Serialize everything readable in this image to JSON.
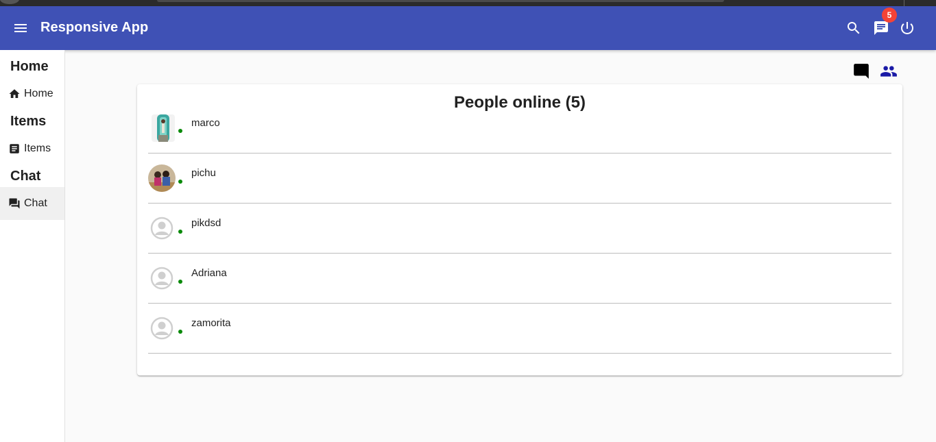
{
  "app": {
    "title": "Responsive App",
    "notification_count": "5"
  },
  "sidebar": {
    "sections": [
      {
        "heading": "Home",
        "item": "Home"
      },
      {
        "heading": "Items",
        "item": "Items"
      },
      {
        "heading": "Chat",
        "item": "Chat"
      }
    ],
    "active": "Chat"
  },
  "main": {
    "title": "People online (5)",
    "people": [
      {
        "name": "marco",
        "avatar": "photo-1",
        "online": true
      },
      {
        "name": "pichu",
        "avatar": "photo-2",
        "online": true
      },
      {
        "name": "pikdsd",
        "avatar": "default-avatar",
        "online": true
      },
      {
        "name": "Adriana",
        "avatar": "default-avatar",
        "online": true
      },
      {
        "name": "zamorita",
        "avatar": "default-avatar",
        "online": true
      }
    ]
  },
  "colors": {
    "appbar": "#3f51b5",
    "badge": "#f44336",
    "online": "#0a8a0a",
    "active_view_icon": "#1a237e"
  }
}
